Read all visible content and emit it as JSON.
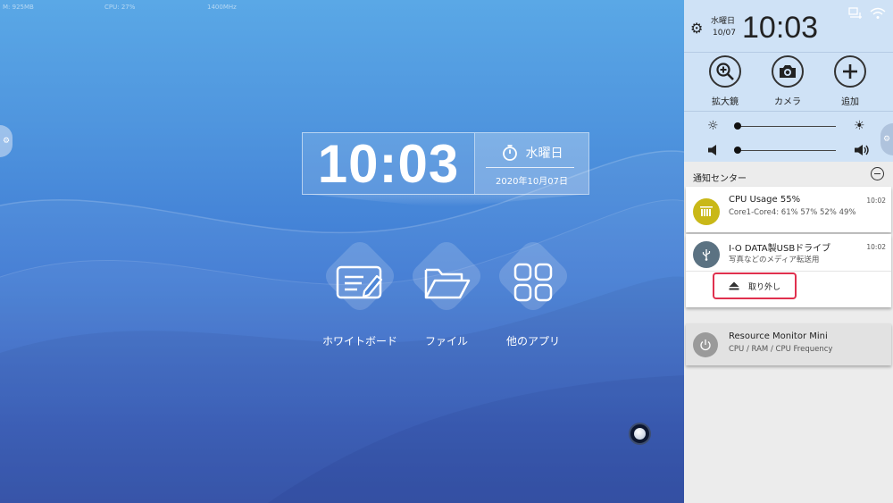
{
  "desktop": {
    "status": {
      "memory": "M: 925MB",
      "cpu": "CPU: 27%",
      "freq": "1400MHz"
    },
    "clock": {
      "time": "10:03",
      "day": "水曜日",
      "date": "2020年10月07日"
    },
    "apps": [
      {
        "label": "ホワイトボード",
        "icon": "whiteboard-icon"
      },
      {
        "label": "ファイル",
        "icon": "folder-icon"
      },
      {
        "label": "他のアプリ",
        "icon": "apps-grid-icon"
      }
    ]
  },
  "panel": {
    "quick_settings": {
      "day": "水曜日",
      "date": "10/07",
      "time": "10:03",
      "buttons": [
        {
          "label": "拡大鏡",
          "icon": "magnifier-icon"
        },
        {
          "label": "カメラ",
          "icon": "camera-icon"
        },
        {
          "label": "追加",
          "icon": "plus-icon"
        }
      ],
      "brightness": 0.02,
      "volume": 0.02
    },
    "notification_center": {
      "title": "通知センター",
      "items": [
        {
          "title": "CPU Usage 55%",
          "subtitle": "Core1-Core4: 61% 57% 52% 49%",
          "time": "10:02",
          "icon": "cpu-icon",
          "color": "#c9b818"
        },
        {
          "title": "I-O DATA製USBドライブ",
          "subtitle": "写真などのメディア転送用",
          "time": "10:02",
          "icon": "usb-icon",
          "color": "#5b7282",
          "action": "取り外し"
        },
        {
          "title": "Resource Monitor Mini",
          "subtitle": "CPU / RAM / CPU Frequency",
          "icon": "power-icon",
          "color": "#9a9a9a"
        }
      ]
    }
  }
}
